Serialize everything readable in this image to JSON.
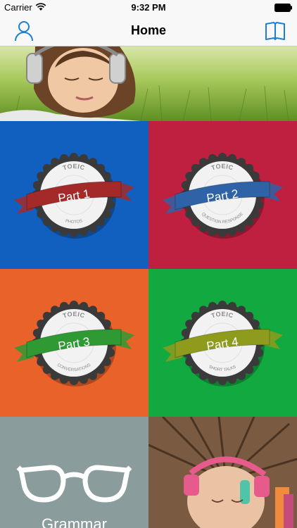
{
  "status_bar": {
    "carrier": "Carrier",
    "time": "9:32 PM"
  },
  "nav": {
    "title": "Home",
    "left_icon": "profile-icon",
    "right_icon": "book-icon"
  },
  "tiles": [
    {
      "label": "Part 1",
      "top": "TOEIC",
      "bottom": "PHOTOS",
      "bg": "#1160c0",
      "ribbon": "#a42a2a"
    },
    {
      "label": "Part 2",
      "top": "TOEIC",
      "bottom": "QUESTION RESPONSE",
      "bg": "#bf2040",
      "ribbon": "#2e63a8"
    },
    {
      "label": "Part 3",
      "top": "TOEIC",
      "bottom": "CONVERSATIONS",
      "bg": "#e8622a",
      "ribbon": "#2f9a33"
    },
    {
      "label": "Part 4",
      "top": "TOEIC",
      "bottom": "SHORT TALKS",
      "bg": "#12aa40",
      "ribbon": "#8e9b1c"
    }
  ],
  "glasses_tile": {
    "bg": "#8a9c9c",
    "icon": "glasses-icon",
    "caption": "Grammar"
  },
  "colors": {
    "nav_bg": "#f8f8f8",
    "accent": "#1a7fd6"
  }
}
